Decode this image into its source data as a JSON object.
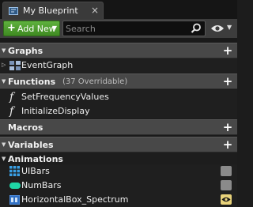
{
  "tab": {
    "title": "My Blueprint",
    "close": "×",
    "icon": "blueprint-icon"
  },
  "toolbar": {
    "add_label": "Add New",
    "search_placeholder": "Search",
    "colors": {
      "add_button": "#4a9a2c"
    }
  },
  "sections": {
    "graphs": {
      "title": "Graphs",
      "add": "+",
      "items": [
        {
          "label": "EventGraph",
          "icon": "event-graph-icon"
        }
      ]
    },
    "functions": {
      "title": "Functions",
      "subtitle": "(37 Overridable)",
      "add": "+",
      "items": [
        {
          "label": "SetFrequencyValues",
          "icon": "function-icon",
          "glyph": "f"
        },
        {
          "label": "InitializeDisplay",
          "icon": "function-icon",
          "glyph": "f"
        }
      ]
    },
    "macros": {
      "title": "Macros",
      "add": "+"
    },
    "variables": {
      "title": "Variables",
      "add": "+",
      "categories": [
        {
          "title": "Animations",
          "items": [
            {
              "label": "UIBars",
              "icon": "grid-variable-icon",
              "visible": false
            },
            {
              "label": "NumBars",
              "icon": "integer-variable-icon",
              "visible": false
            },
            {
              "label": "HorizontalBox_Spectrum",
              "icon": "widget-variable-icon",
              "visible": true
            }
          ]
        }
      ]
    }
  }
}
